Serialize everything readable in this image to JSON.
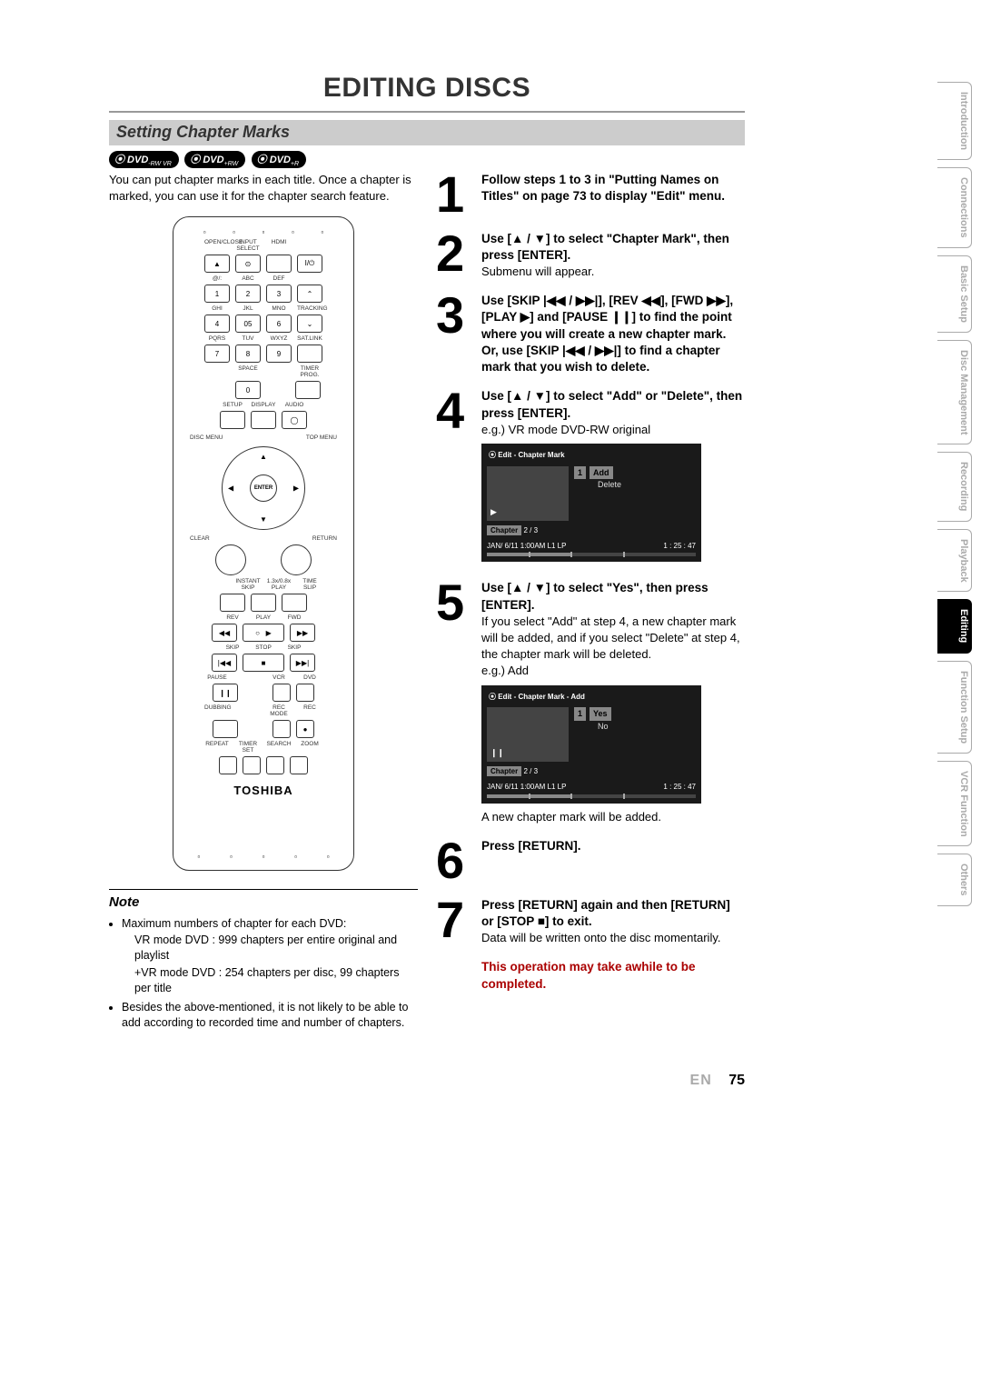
{
  "title": "EDITING DISCS",
  "section": "Setting Chapter Marks",
  "badges": [
    "DVD -RW VR MODE",
    "DVD +RW",
    "DVD +R"
  ],
  "intro": "You can put chapter marks in each title. Once a chapter is marked, you can use it for the chapter search feature.",
  "remote": {
    "top_labels1": [
      "OPEN/CLOSE",
      "INPUT SELECT",
      "HDMI",
      ""
    ],
    "row1": [
      "▲",
      "⊙",
      "",
      "I/⏻"
    ],
    "top_labels2": [
      "@/:",
      "ABC",
      "DEF",
      ""
    ],
    "row2": [
      "1",
      "2",
      "3",
      "⌃"
    ],
    "top_labels3": [
      "GHI",
      "JKL",
      "MNO",
      "TRACKING"
    ],
    "row3": [
      "4",
      "05",
      "6",
      "⌄"
    ],
    "top_labels4": [
      "PQRS",
      "TUV",
      "WXYZ",
      "SAT.LINK"
    ],
    "row4": [
      "7",
      "8",
      "9",
      ""
    ],
    "top_labels5": [
      "",
      "SPACE",
      "",
      "TIMER PROG."
    ],
    "row5": [
      "",
      "0",
      "",
      ""
    ],
    "row6_lbl": [
      "SETUP",
      "DISPLAY",
      "AUDIO"
    ],
    "disc_menu": "DISC MENU",
    "top_menu": "TOP MENU",
    "enter": "ENTER",
    "clear": "CLEAR",
    "return": "RETURN",
    "row7_lbl": [
      "",
      "INSTANT SKIP",
      "1.3x/0.8x PLAY",
      "TIME SLIP"
    ],
    "rev": "REV",
    "play": "PLAY",
    "fwd": "FWD",
    "skip": "SKIP",
    "stop": "STOP",
    "pause": "PAUSE",
    "vcr": "VCR",
    "dvd": "DVD",
    "dubbing": "DUBBING",
    "recmode": "REC MODE",
    "rec": "REC",
    "bottom_lbl": [
      "REPEAT",
      "TIMER SET",
      "SEARCH",
      "ZOOM"
    ],
    "brand": "TOSHIBA"
  },
  "note": {
    "title": "Note",
    "items": [
      "Maximum numbers of chapter for each DVD:",
      "VR mode DVD : 999 chapters per entire original and playlist",
      "+VR mode DVD : 254 chapters per disc, 99 chapters per title",
      "Besides the above-mentioned, it is not likely to be able to add according to recorded time and number of chapters."
    ]
  },
  "steps": {
    "s1": "Follow steps 1 to 3 in \"Putting Names on Titles\" on page 73 to display \"Edit\" menu.",
    "s2": "Use [▲ / ▼] to select \"Chapter Mark\", then press [ENTER].",
    "s2sub": "Submenu will appear.",
    "s3": "Use [SKIP |◀◀ / ▶▶|], [REV ◀◀], [FWD ▶▶], [PLAY ▶] and [PAUSE ❙❙] to find the point where you will create a new chapter mark. Or, use [SKIP |◀◀ / ▶▶|] to find a chapter mark that you wish to delete.",
    "s4": "Use [▲ / ▼] to select \"Add\" or \"Delete\", then press [ENTER].",
    "s4sub": "e.g.) VR mode DVD-RW original",
    "s5": "Use [▲ / ▼] to select \"Yes\", then press [ENTER].",
    "s5sub": "If you select \"Add\" at step 4, a new chapter mark will be added, and if you select \"Delete\" at step 4, the chapter mark will be deleted.",
    "s5sub2": "e.g.) Add",
    "s5sub3": "A new chapter mark will be added.",
    "s6": "Press [RETURN].",
    "s7": "Press [RETURN] again and then [RETURN] or [STOP ■] to exit.",
    "s7sub": "Data will be written onto the disc momentarily.",
    "warning": "This operation may take awhile to be completed."
  },
  "osd1": {
    "title": "Edit - Chapter Mark",
    "menu_num": "1",
    "options": [
      "Add",
      "Delete"
    ],
    "chapter_label": "Chapter",
    "chapter_val": "2 / 3",
    "time": "1 : 25 : 47",
    "info": "JAN/ 6/11 1:00AM L1   LP",
    "icon": "▶"
  },
  "osd2": {
    "title": "Edit - Chapter Mark - Add",
    "menu_num": "1",
    "options": [
      "Yes",
      "No"
    ],
    "chapter_label": "Chapter",
    "chapter_val": "2 / 3",
    "time": "1 : 25 : 47",
    "info": "JAN/ 6/11 1:00AM L1   LP",
    "icon": "❙❙"
  },
  "tabs": [
    "Introduction",
    "Connections",
    "Basic Setup",
    "Disc Management",
    "Recording",
    "Playback",
    "Editing",
    "Function Setup",
    "VCR Function",
    "Others"
  ],
  "active_tab": "Editing",
  "footer": {
    "lang": "EN",
    "page": "75"
  }
}
